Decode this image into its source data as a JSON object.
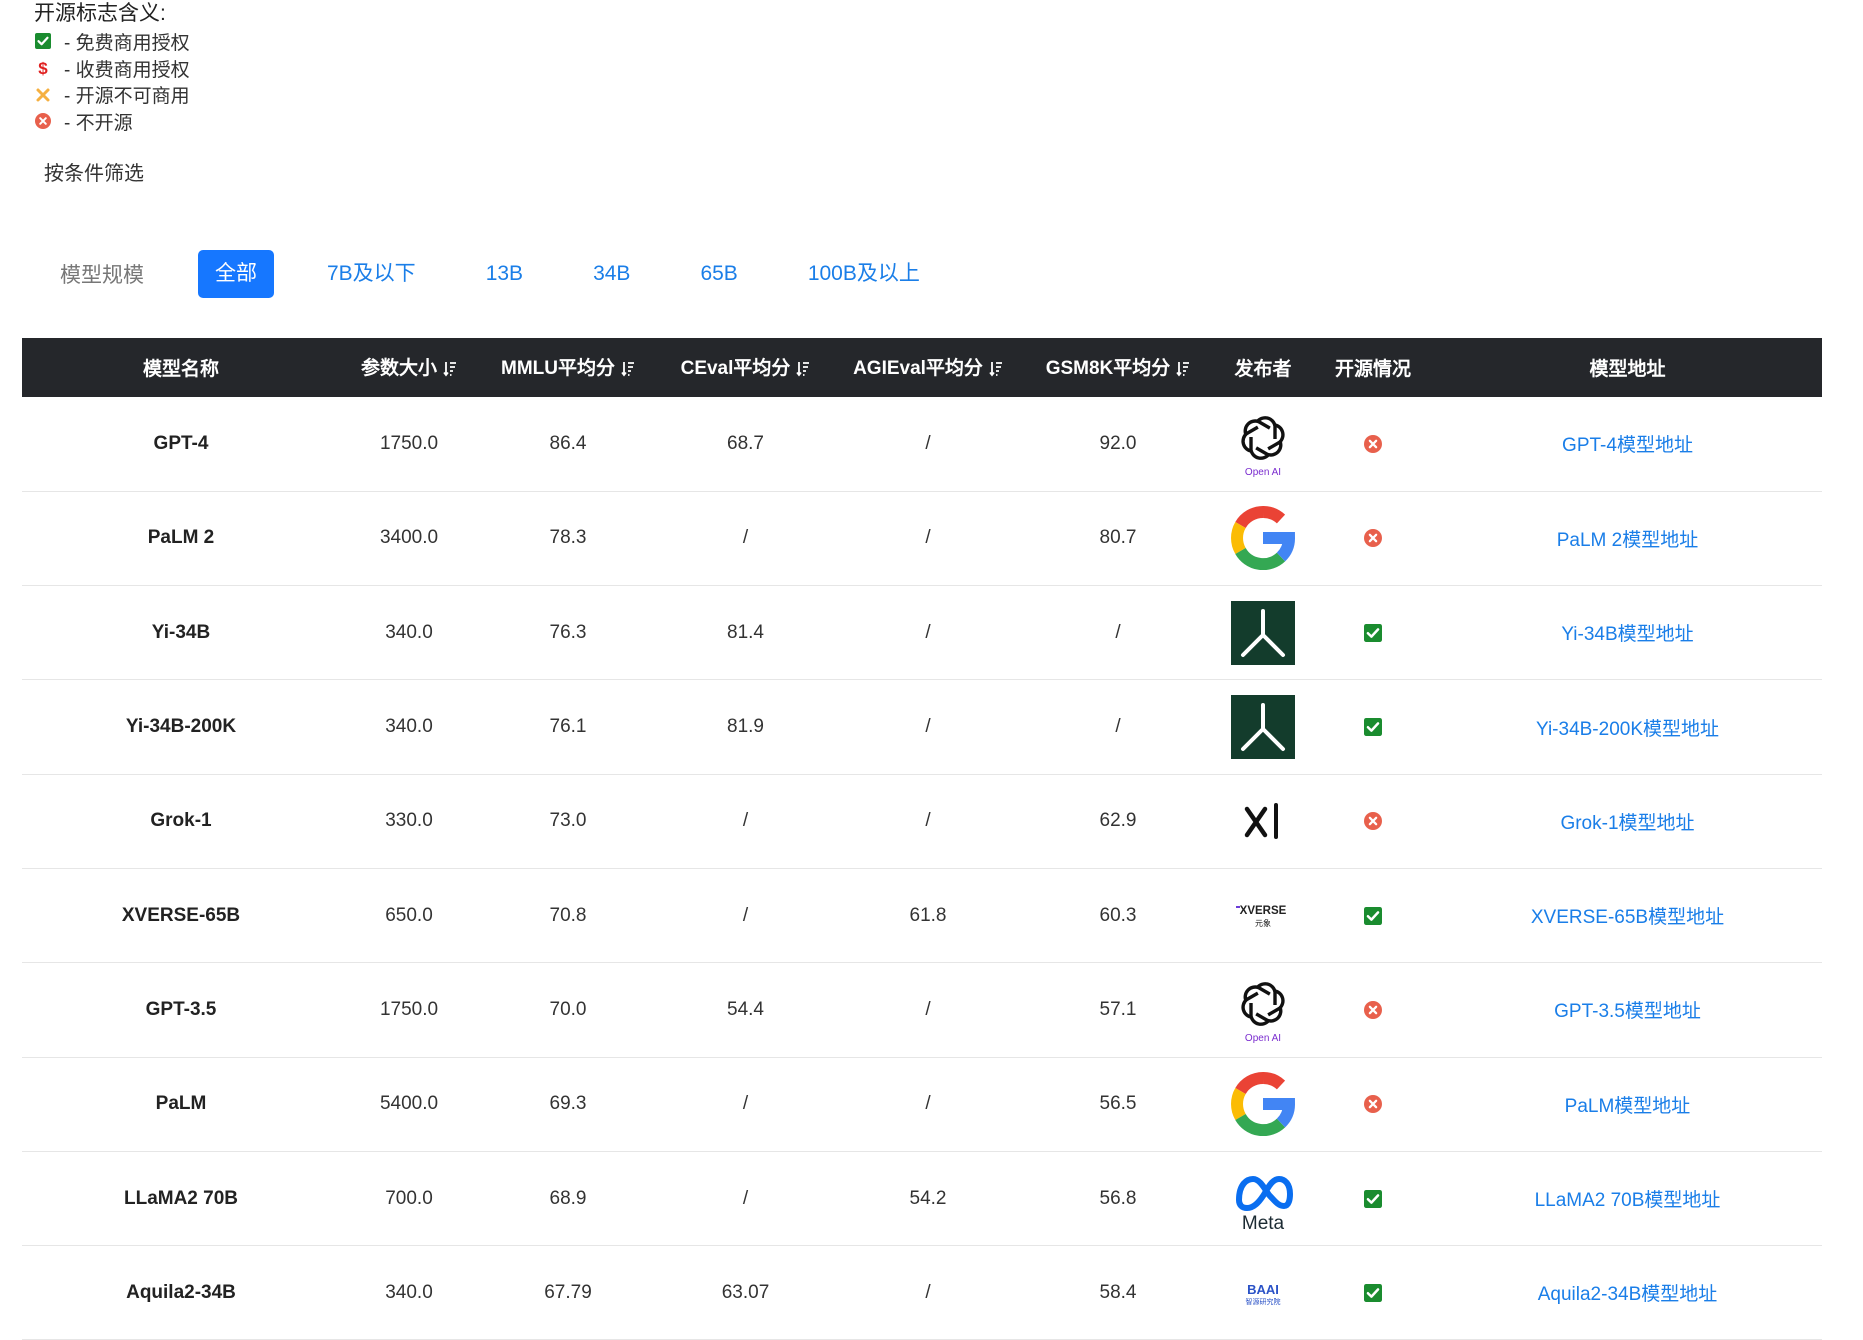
{
  "legend": {
    "title": "开源标志含义:",
    "items": [
      {
        "icon": "green-check-icon",
        "label": "- 免费商用授权"
      },
      {
        "icon": "dollar-icon",
        "label": "- 收费商用授权"
      },
      {
        "icon": "orange-x-icon",
        "label": "- 开源不可商用"
      },
      {
        "icon": "red-circle-x-icon",
        "label": "- 不开源"
      }
    ]
  },
  "filter": {
    "title": "按条件筛选",
    "label": "模型规模",
    "options": [
      "全部",
      "7B及以下",
      "13B",
      "34B",
      "65B",
      "100B及以上"
    ],
    "selected": "全部"
  },
  "table": {
    "headers": {
      "name": "模型名称",
      "params": "参数大小",
      "mmlu": "MMLU平均分",
      "ceval": "CEval平均分",
      "agieval": "AGIEval平均分",
      "gsm8k": "GSM8K平均分",
      "publisher": "发布者",
      "open": "开源情况",
      "url": "模型地址"
    },
    "rows": [
      {
        "name": "GPT-4",
        "params": "1750.0",
        "mmlu": "86.4",
        "ceval": "68.7",
        "agieval": "/",
        "gsm8k": "92.0",
        "publisher_logo": "openai-logo",
        "logo_text": "Open AI",
        "open": "not-open-source",
        "url": "GPT-4模型地址"
      },
      {
        "name": "PaLM 2",
        "params": "3400.0",
        "mmlu": "78.3",
        "ceval": "/",
        "agieval": "/",
        "gsm8k": "80.7",
        "publisher_logo": "google-logo",
        "logo_text": "",
        "open": "not-open-source",
        "url": "PaLM 2模型地址"
      },
      {
        "name": "Yi-34B",
        "params": "340.0",
        "mmlu": "76.3",
        "ceval": "81.4",
        "agieval": "/",
        "gsm8k": "/",
        "publisher_logo": "01ai-logo",
        "logo_text": "",
        "open": "free-commercial",
        "url": "Yi-34B模型地址"
      },
      {
        "name": "Yi-34B-200K",
        "params": "340.0",
        "mmlu": "76.1",
        "ceval": "81.9",
        "agieval": "/",
        "gsm8k": "/",
        "publisher_logo": "01ai-logo",
        "logo_text": "",
        "open": "free-commercial",
        "url": "Yi-34B-200K模型地址"
      },
      {
        "name": "Grok-1",
        "params": "330.0",
        "mmlu": "73.0",
        "ceval": "/",
        "agieval": "/",
        "gsm8k": "62.9",
        "publisher_logo": "xai-logo",
        "logo_text": "",
        "open": "not-open-source",
        "url": "Grok-1模型地址"
      },
      {
        "name": "XVERSE-65B",
        "params": "650.0",
        "mmlu": "70.8",
        "ceval": "/",
        "agieval": "61.8",
        "gsm8k": "60.3",
        "publisher_logo": "xverse-logo",
        "logo_text": "XVERSE 元象",
        "open": "free-commercial",
        "url": "XVERSE-65B模型地址"
      },
      {
        "name": "GPT-3.5",
        "params": "1750.0",
        "mmlu": "70.0",
        "ceval": "54.4",
        "agieval": "/",
        "gsm8k": "57.1",
        "publisher_logo": "openai-logo",
        "logo_text": "Open AI",
        "open": "not-open-source",
        "url": "GPT-3.5模型地址"
      },
      {
        "name": "PaLM",
        "params": "5400.0",
        "mmlu": "69.3",
        "ceval": "/",
        "agieval": "/",
        "gsm8k": "56.5",
        "publisher_logo": "google-logo",
        "logo_text": "",
        "open": "not-open-source",
        "url": "PaLM模型地址"
      },
      {
        "name": "LLaMA2 70B",
        "params": "700.0",
        "mmlu": "68.9",
        "ceval": "/",
        "agieval": "54.2",
        "gsm8k": "56.8",
        "publisher_logo": "meta-logo",
        "logo_text": "Meta",
        "open": "free-commercial",
        "url": "LLaMA2 70B模型地址"
      },
      {
        "name": "Aquila2-34B",
        "params": "340.0",
        "mmlu": "67.79",
        "ceval": "63.07",
        "agieval": "/",
        "gsm8k": "58.4",
        "publisher_logo": "baai-logo",
        "logo_text": "BAAI 智源研究院",
        "open": "free-commercial",
        "url": "Aquila2-34B模型地址"
      }
    ]
  },
  "colors": {
    "accent": "#1677ff",
    "link": "#1a7ee8",
    "header_bg": "#25272b",
    "check_green": "#1a8c2f",
    "not_open_red": "#e8604c",
    "dollar_red": "#e02020",
    "orange_x": "#f5b041"
  }
}
